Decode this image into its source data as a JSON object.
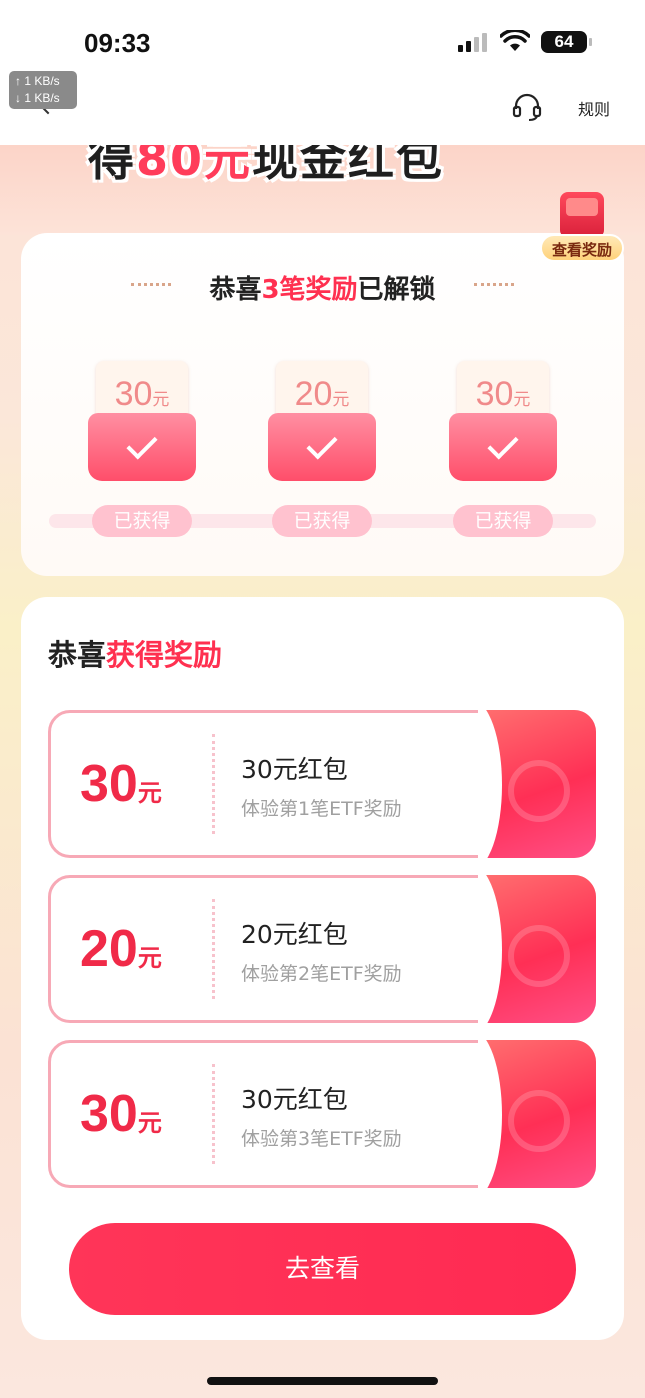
{
  "status_bar": {
    "time": "09:33",
    "battery": "64",
    "net_up": "↑ 1 KB/s",
    "net_down": "↓ 1 KB/s"
  },
  "nav": {
    "rules_label": "规则"
  },
  "hero": {
    "title_prefix": "得",
    "title_amount": "80元",
    "title_suffix": "现金红包"
  },
  "view_reward": {
    "label": "查看奖励"
  },
  "unlocked": {
    "title_prefix": "恭喜",
    "title_highlight": "3笔奖励",
    "title_suffix": "已解锁",
    "envelopes": [
      {
        "amount": "30",
        "unit": "元",
        "status": "已获得"
      },
      {
        "amount": "20",
        "unit": "元",
        "status": "已获得"
      },
      {
        "amount": "30",
        "unit": "元",
        "status": "已获得"
      }
    ]
  },
  "rewards": {
    "title_prefix": "恭喜",
    "title_highlight": "获得奖励",
    "items": [
      {
        "amount": "30",
        "unit": "元",
        "name": "30元红包",
        "desc": "体验第1笔ETF奖励"
      },
      {
        "amount": "20",
        "unit": "元",
        "name": "20元红包",
        "desc": "体验第2笔ETF奖励"
      },
      {
        "amount": "30",
        "unit": "元",
        "name": "30元红包",
        "desc": "体验第3笔ETF奖励"
      }
    ],
    "cta_label": "去查看"
  }
}
